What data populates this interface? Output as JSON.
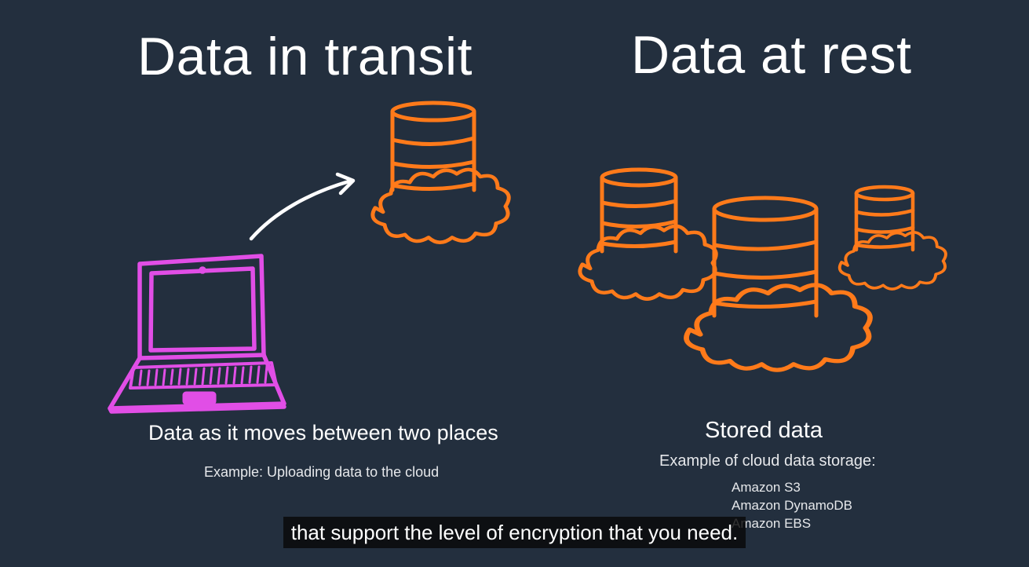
{
  "slide": {
    "left": {
      "title": "Data in transit",
      "description": "Data as it moves between two places",
      "example": "Example: Uploading data to the cloud"
    },
    "right": {
      "title": "Data at rest",
      "description": "Stored data",
      "example": "Example of cloud data storage:",
      "services": [
        "Amazon S3",
        "Amazon DynamoDB",
        "Amazon EBS"
      ]
    }
  },
  "caption": "that support the level of encryption that you need.",
  "colors": {
    "background": "#232f3e",
    "laptop": "#e14ee6",
    "database": "#ff7a1a",
    "text": "#ffffff"
  },
  "icons": [
    "laptop-icon",
    "arrow-icon",
    "cloud-database-icon"
  ]
}
